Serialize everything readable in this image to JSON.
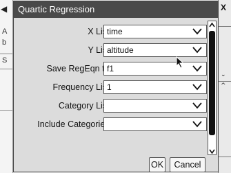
{
  "background": {
    "left_chars": [
      "A",
      "b",
      "S"
    ],
    "left_arrow_icon": "◀",
    "right_close_label": "X"
  },
  "dialog": {
    "title": "Quartic Regression",
    "fields": [
      {
        "label": "X List:",
        "value": "time"
      },
      {
        "label": "Y List:",
        "value": "altitude"
      },
      {
        "label": "Save RegEqn to:",
        "value": "f1"
      },
      {
        "label": "Frequency List:",
        "value": "1"
      },
      {
        "label": "Category List:",
        "value": ""
      },
      {
        "label": "Include Categories:",
        "value": ""
      }
    ],
    "ok_label": "OK",
    "cancel_label": "Cancel"
  },
  "colors": {
    "titlebar": "#4a4a4a",
    "dialog_bg": "#dcdcdc",
    "field_bg": "#ffffff"
  },
  "icons": [
    "dropdown-chevron-icon",
    "scroll-up-icon",
    "scroll-down-icon",
    "mouse-cursor-icon"
  ]
}
